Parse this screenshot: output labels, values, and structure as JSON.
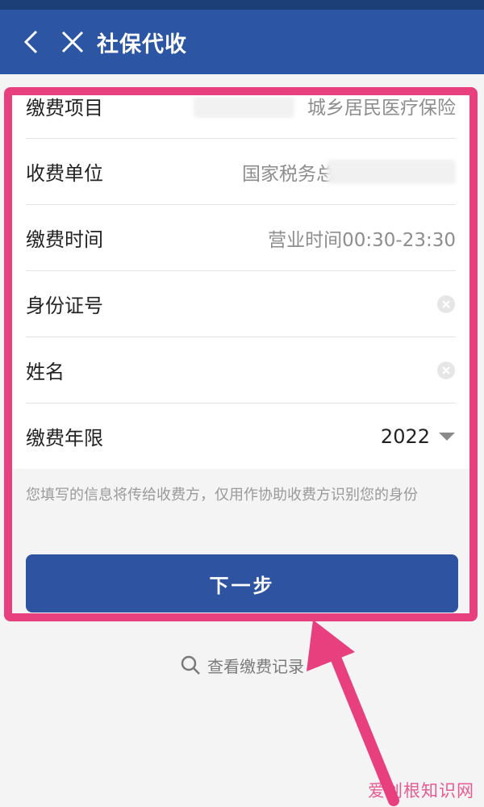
{
  "header": {
    "title": "社保代收"
  },
  "form": {
    "rows": [
      {
        "label": "缴费项目",
        "value": "城乡居民医疗保险"
      },
      {
        "label": "收费单位",
        "value": "国家税务总"
      },
      {
        "label": "缴费时间",
        "value": "营业时间00:30-23:30"
      },
      {
        "label": "身份证号",
        "value": ""
      },
      {
        "label": "姓名",
        "value": ""
      },
      {
        "label": "缴费年限",
        "value": "2022"
      }
    ]
  },
  "note": "您填写的信息将传给收费方，仅用作协助收费方识别您的身份",
  "next_button": "下一步",
  "records_link": "查看缴费记录",
  "watermark": "爱创根知识网",
  "colors": {
    "header_bg": "#2c55a3",
    "button_bg": "#2e54a1",
    "highlight": "#e8407f"
  }
}
